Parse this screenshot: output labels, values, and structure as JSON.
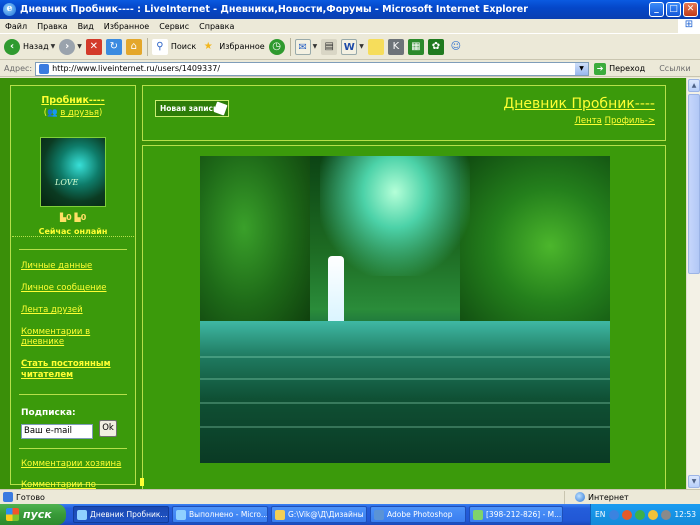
{
  "window": {
    "title": "Дневник Пробник---- : LiveInternet - Дневники,Новости,Форумы - Microsoft Internet Explorer",
    "ie_icon": "e"
  },
  "menubar": {
    "items": [
      "Файл",
      "Правка",
      "Вид",
      "Избранное",
      "Сервис",
      "Справка"
    ]
  },
  "toolbar": {
    "back_label": "Назад",
    "search_label": "Поиск",
    "favorites_label": "Избранное"
  },
  "addressbar": {
    "label": "Адрес:",
    "url": "http://www.liveinternet.ru/users/1409337/",
    "go_label": "Переход",
    "links_label": "Ссылки"
  },
  "page": {
    "username": "Пробник----",
    "add_friend": "в друзья",
    "avatar_text": "LOVE",
    "badge_a": "0",
    "badge_b": "0",
    "online_status": "Сейчас онлайн",
    "nav_links": [
      "Личные данные",
      "Личное сообщение",
      "Лента друзей",
      "Комментарии в дневнике",
      "Стать постоянным читателем"
    ],
    "subscribe_label": "Подписка:",
    "email_placeholder": "Ваш e-mail",
    "ok_label": "Ok",
    "bottom_links": [
      "Комментарии хозяина",
      "Комментарии по"
    ],
    "new_post_label": "Новая запись",
    "diary_title": "Дневник Пробник----",
    "feed_link": "Лента",
    "profile_link": "Профиль->"
  },
  "statusbar": {
    "status_text": "Готово",
    "zone_text": "Интернет"
  },
  "taskbar": {
    "start_label": "пуск",
    "tasks": [
      "Дневник Пробник...",
      "Выполнено - Micro...",
      "G:\\Vik@\\Д\\Дизайны",
      "Adobe Photoshop",
      "[398-212-826] - M..."
    ],
    "lang": "EN",
    "clock": "12:53"
  },
  "colors": {
    "page_bg": "#3a8f09",
    "panel_bg": "#3b9a0b",
    "border": "#b6e04a",
    "link": "#ffff33"
  }
}
